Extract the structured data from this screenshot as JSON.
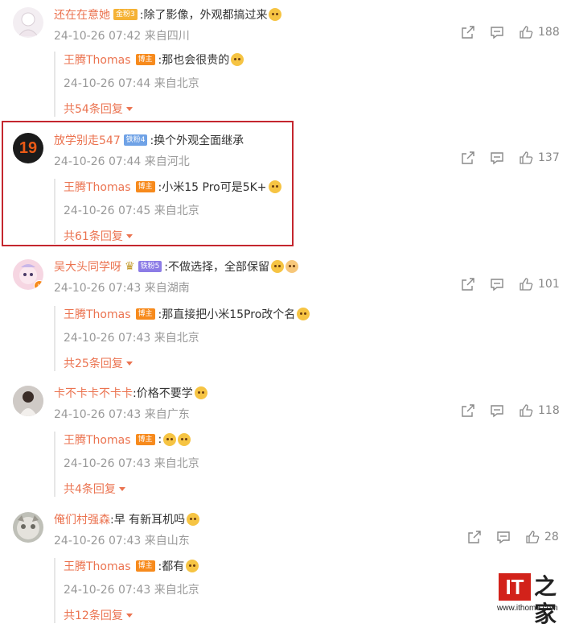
{
  "comments": [
    {
      "user": "还在在意她",
      "fan_badge": "金粉3",
      "text": ":除了影像，外观都搞过来",
      "meta": "24-10-26 07:42 来自四川",
      "likes": "188",
      "reply": {
        "user": "王腾Thomas",
        "badge": "博主",
        "text": ":那也会很贵的",
        "meta": "24-10-26 07:44 来自北京"
      },
      "more": "共54条回复"
    },
    {
      "user": "放学别走547",
      "fan_badge": "铁粉4",
      "text": ":换个外观全面继承",
      "meta": "24-10-26 07:44 来自河北",
      "likes": "137",
      "reply": {
        "user": "王腾Thomas",
        "badge": "博主",
        "text": ":小米15 Pro可是5K+",
        "meta": "24-10-26 07:45 来自北京"
      },
      "more": "共61条回复"
    },
    {
      "user": "吴大头同学呀",
      "fan_badge": "铁粉5",
      "text": ":不做选择，全部保留",
      "meta": "24-10-26 07:43 来自湖南",
      "likes": "101",
      "reply": {
        "user": "王腾Thomas",
        "badge": "博主",
        "text": ":那直接把小米15Pro改个名",
        "meta": "24-10-26 07:43 来自北京"
      },
      "more": "共25条回复"
    },
    {
      "user": "卡不卡卡不卡卡",
      "text": ":价格不要学",
      "meta": "24-10-26 07:43 来自广东",
      "likes": "118",
      "reply": {
        "user": "王腾Thomas",
        "badge": "博主",
        "text": ":",
        "meta": "24-10-26 07:43 来自北京"
      },
      "more": "共4条回复"
    },
    {
      "user": "俺们村强森",
      "text": ":早  有新耳机吗",
      "meta": "24-10-26 07:43 来自山东",
      "likes": "28",
      "reply": {
        "user": "王腾Thomas",
        "badge": "博主",
        "text": ":都有",
        "meta": "24-10-26 07:43 来自北京"
      },
      "more": "共12条回复"
    }
  ],
  "avatar2_text": "19",
  "logo": {
    "it": "IT",
    "zhi": "之家",
    "url": "www.ithome.com"
  }
}
